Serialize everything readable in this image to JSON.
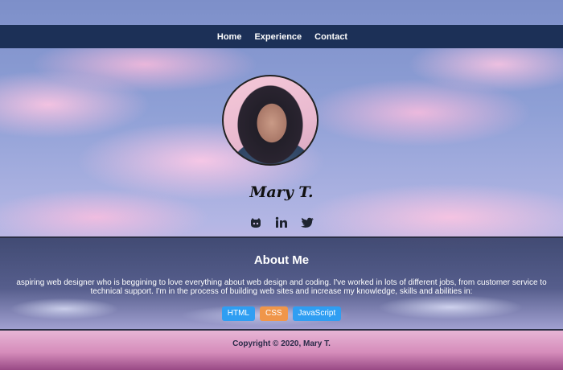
{
  "nav": {
    "items": [
      "Home",
      "Experience",
      "Contact"
    ]
  },
  "profile": {
    "name": "Mary T.",
    "socials": [
      "github-icon",
      "linkedin-icon",
      "twitter-icon"
    ]
  },
  "about": {
    "title": "About Me",
    "line1": "aspiring web designer who is beggining to love everything about web design and coding. I've worked in lots of different jobs, from customer service to",
    "line2": "technical support. I'm in the process of building web sites and increase my knowledge, skills and abilities in:",
    "skills": [
      {
        "label": "HTML",
        "color": "#2f9ef2"
      },
      {
        "label": "CSS",
        "color": "#f0964a"
      },
      {
        "label": "JavaScript",
        "color": "#2f9ef2"
      }
    ]
  },
  "footer": {
    "copyright": "Copyright © 2020, Mary T."
  },
  "colors": {
    "nav_bg": "#1c3057",
    "divider": "#2b2f45"
  }
}
